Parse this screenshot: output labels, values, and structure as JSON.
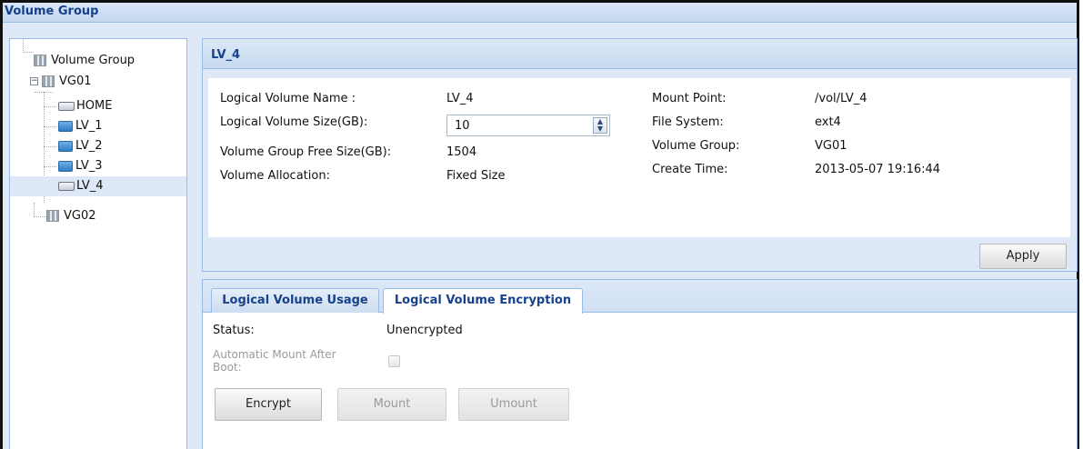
{
  "app": {
    "title": "Volume Group"
  },
  "tree": {
    "root": {
      "label": "Volume Group"
    },
    "vg01": {
      "label": "VG01"
    },
    "home": {
      "label": "HOME"
    },
    "lv1": {
      "label": "LV_1"
    },
    "lv2": {
      "label": "LV_2"
    },
    "lv3": {
      "label": "LV_3"
    },
    "lv4": {
      "label": "LV_4"
    },
    "vg02": {
      "label": "VG02"
    }
  },
  "detail": {
    "title": "LV_4",
    "fields": {
      "lv_name_label": "Logical Volume Name :",
      "lv_name_value": "LV_4",
      "lv_size_label": "Logical Volume Size(GB):",
      "lv_size_value": "10",
      "vg_free_label": "Volume Group Free Size(GB):",
      "vg_free_value": "1504",
      "allocation_label": "Volume Allocation:",
      "allocation_value": "Fixed Size",
      "mount_point_label": "Mount Point:",
      "mount_point_value": "/vol/LV_4",
      "file_system_label": "File System:",
      "file_system_value": "ext4",
      "volume_group_label": "Volume Group:",
      "volume_group_value": "VG01",
      "create_time_label": "Create Time:",
      "create_time_value": "2013-05-07 19:16:44"
    },
    "apply_label": "Apply"
  },
  "tabs": [
    {
      "label": "Logical Volume Usage",
      "active": false
    },
    {
      "label": "Logical Volume Encryption",
      "active": true
    }
  ],
  "encryption": {
    "status_label": "Status:",
    "status_value": "Unencrypted",
    "auto_mount_label_line1": "Automatic Mount After",
    "auto_mount_label_line2": "Boot:",
    "auto_mount_checked": false,
    "encrypt_label": "Encrypt",
    "mount_label": "Mount",
    "umount_label": "Umount"
  },
  "colors": {
    "panel_header_text": "#15428b",
    "panel_border": "#99bbe8",
    "panel_bg": "#dfe8f6"
  }
}
